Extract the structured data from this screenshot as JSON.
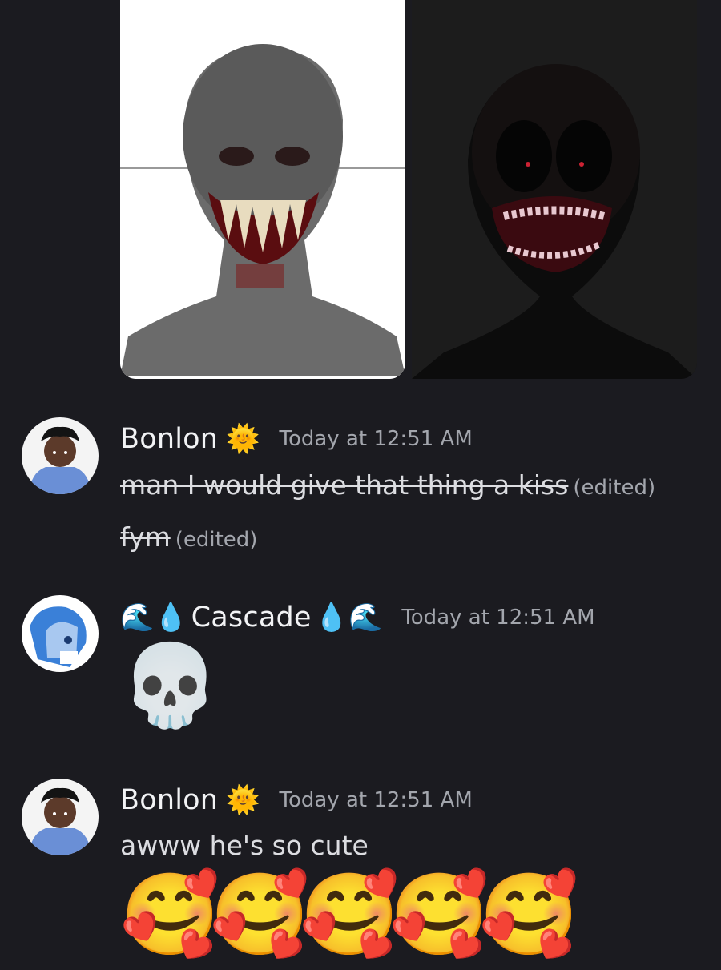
{
  "messages": [
    {
      "author": "Bonlon",
      "author_emoji": "🌞",
      "timestamp": "Today at 12:51 AM",
      "lines": [
        {
          "text": "man I would give that thing a kiss",
          "strikethrough": true,
          "edited": "(edited)"
        },
        {
          "text": "fym",
          "strikethrough": true,
          "edited": "(edited)"
        }
      ]
    },
    {
      "author": "Cascade",
      "author_prefix": "🌊💧",
      "author_suffix": "💧🌊",
      "timestamp": "Today at 12:51 AM",
      "emoji": "💀"
    },
    {
      "author": "Bonlon",
      "author_emoji": "🌞",
      "timestamp": "Today at 12:51 AM",
      "text": "awww he's so cute",
      "emojis": [
        "🥰",
        "🥰",
        "🥰",
        "🥰",
        "🥰"
      ]
    }
  ],
  "icons": {
    "sun_face": "sun-with-face-icon",
    "water_wave": "water-wave-icon",
    "droplet": "droplet-icon",
    "skull": "skull-icon",
    "smiling_hearts": "smiling-face-with-hearts-icon"
  },
  "colors": {
    "background": "#1b1b20",
    "username": "#f2f3f5",
    "timestamp": "#a3a6ad",
    "text": "#dcdde1"
  }
}
